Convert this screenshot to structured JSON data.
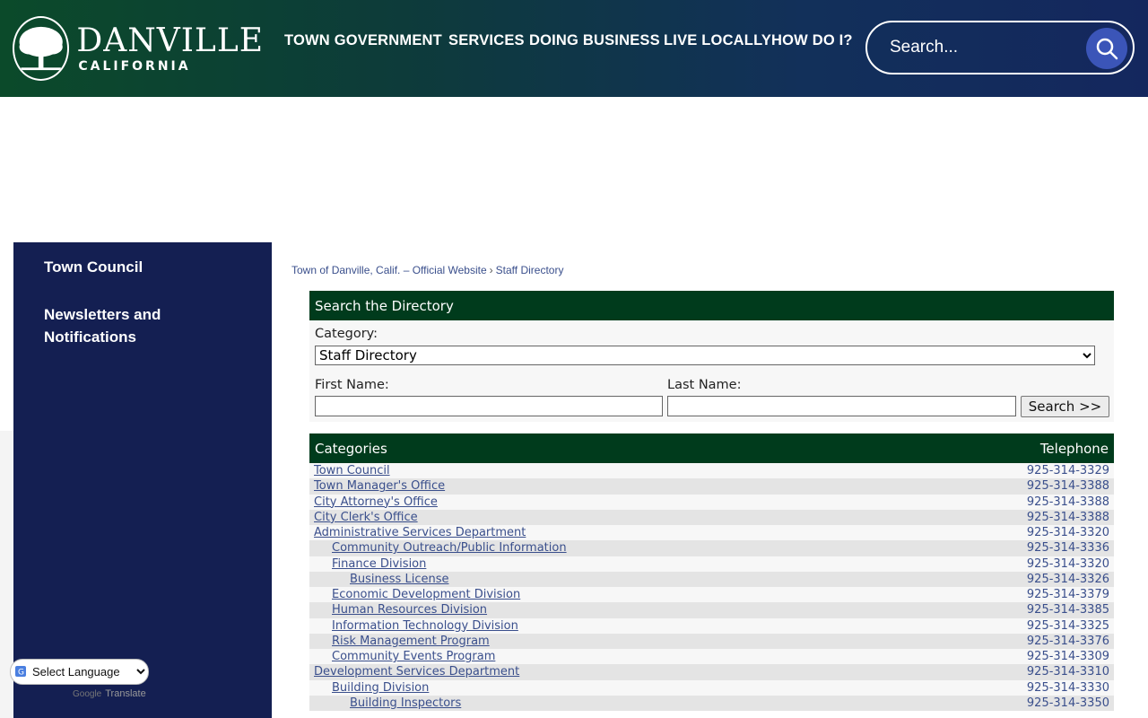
{
  "header": {
    "logo_main": "DANVILLE",
    "logo_sub": "CALIFORNIA",
    "nav": [
      "TOWN GOVERNMENT",
      "SERVICES",
      "DOING BUSINESS",
      "LIVE LOCALLY",
      "HOW DO I?"
    ],
    "search_placeholder": "Search..."
  },
  "sidebar": {
    "items": [
      "Town Council",
      "Newsletters and Notifications"
    ]
  },
  "breadcrumb": {
    "home": "Town of Danville, Calif. – Official Website",
    "separator": "›",
    "current": "Staff Directory"
  },
  "search_panel": {
    "title": "Search the Directory",
    "category_label": "Category:",
    "category_value": "Staff Directory",
    "first_name_label": "First Name:",
    "last_name_label": "Last Name:",
    "search_button": "Search >>"
  },
  "categories_panel": {
    "header_left": "Categories",
    "header_right": "Telephone",
    "rows": [
      {
        "name": "Town Council",
        "tel": "925-314-3329",
        "level": 0
      },
      {
        "name": "Town Manager's Office",
        "tel": "925-314-3388",
        "level": 0
      },
      {
        "name": "City Attorney's Office",
        "tel": "925-314-3388",
        "level": 0
      },
      {
        "name": "City Clerk's Office",
        "tel": "925-314-3388",
        "level": 0
      },
      {
        "name": "Administrative Services Department",
        "tel": "925-314-3320",
        "level": 0
      },
      {
        "name": "Community Outreach/Public Information",
        "tel": "925-314-3336",
        "level": 1
      },
      {
        "name": "Finance Division",
        "tel": "925-314-3320",
        "level": 1
      },
      {
        "name": "Business License",
        "tel": "925-314-3326",
        "level": 2
      },
      {
        "name": "Economic Development Division",
        "tel": "925-314-3379",
        "level": 1
      },
      {
        "name": "Human Resources Division",
        "tel": "925-314-3385",
        "level": 1
      },
      {
        "name": "Information Technology Division",
        "tel": "925-314-3325",
        "level": 1
      },
      {
        "name": "Risk Management Program",
        "tel": "925-314-3376",
        "level": 1
      },
      {
        "name": "Community Events Program",
        "tel": "925-314-3309",
        "level": 1
      },
      {
        "name": "Development Services Department",
        "tel": "925-314-3310",
        "level": 0
      },
      {
        "name": "Building Division",
        "tel": "925-314-3330",
        "level": 1
      },
      {
        "name": "Building Inspectors",
        "tel": "925-314-3350",
        "level": 2
      }
    ]
  },
  "translate": {
    "select_label": "Select Language",
    "powered_brand": "Google",
    "powered_text": "Translate"
  },
  "colors": {
    "header_green": "#0b4a2a",
    "header_blue": "#14275e",
    "sidebar_bg": "#141f52",
    "panel_header": "#003b1c",
    "link_blue": "#3a4f8c",
    "search_button_bg": "#3b55b8"
  }
}
